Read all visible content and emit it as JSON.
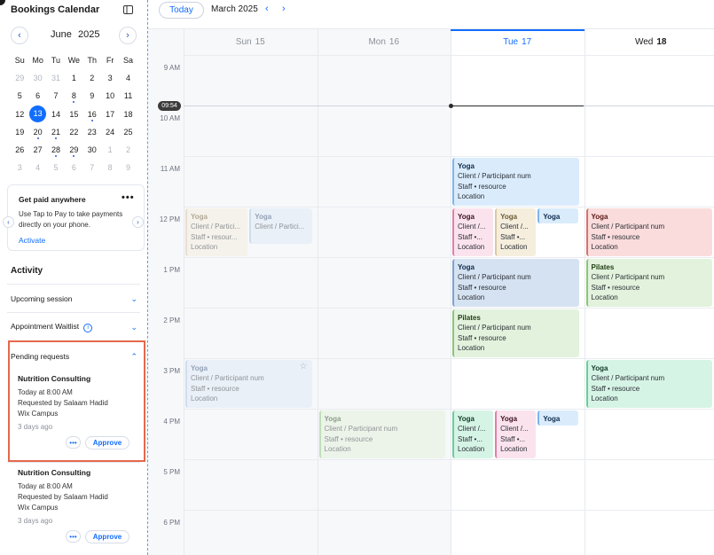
{
  "sidebar": {
    "title": "Bookings Calendar",
    "mini_calendar": {
      "month": "June",
      "year": "2025",
      "prev": "‹",
      "next": "›",
      "weekdays": [
        "Su",
        "Mo",
        "Tu",
        "We",
        "Th",
        "Fr",
        "Sa"
      ],
      "weeks": [
        [
          {
            "d": "29",
            "m": true
          },
          {
            "d": "30",
            "m": true
          },
          {
            "d": "31",
            "m": true
          },
          {
            "d": "1"
          },
          {
            "d": "2"
          },
          {
            "d": "3"
          },
          {
            "d": "4"
          }
        ],
        [
          {
            "d": "5"
          },
          {
            "d": "6"
          },
          {
            "d": "7"
          },
          {
            "d": "8",
            "dot": true
          },
          {
            "d": "9"
          },
          {
            "d": "10"
          },
          {
            "d": "11"
          }
        ],
        [
          {
            "d": "12"
          },
          {
            "d": "13",
            "sel": true
          },
          {
            "d": "14"
          },
          {
            "d": "15"
          },
          {
            "d": "16",
            "dot": true
          },
          {
            "d": "17"
          },
          {
            "d": "18"
          }
        ],
        [
          {
            "d": "19"
          },
          {
            "d": "20",
            "dot": true
          },
          {
            "d": "21",
            "dot": true
          },
          {
            "d": "22"
          },
          {
            "d": "23"
          },
          {
            "d": "24"
          },
          {
            "d": "25"
          }
        ],
        [
          {
            "d": "26"
          },
          {
            "d": "27"
          },
          {
            "d": "28",
            "dot": true
          },
          {
            "d": "29",
            "dot": true
          },
          {
            "d": "30"
          },
          {
            "d": "1",
            "m": true
          },
          {
            "d": "2",
            "m": true
          }
        ],
        [
          {
            "d": "3",
            "m": true
          },
          {
            "d": "4",
            "m": true
          },
          {
            "d": "5",
            "m": true
          },
          {
            "d": "6",
            "m": true
          },
          {
            "d": "7",
            "m": true
          },
          {
            "d": "8",
            "m": true
          },
          {
            "d": "9",
            "m": true
          }
        ]
      ]
    },
    "promo": {
      "title": "Get paid anywhere",
      "more": "•••",
      "text": "Use Tap to Pay to take payments directly on your phone.",
      "link": "Activate",
      "left_arrow": "‹",
      "right_arrow": "›"
    },
    "activity": {
      "heading": "Activity",
      "upcoming": "Upcoming session",
      "waitlist": "Appointment Waitlist",
      "info": "i",
      "pending": "Pending requests",
      "chevron_down": "⌄",
      "chevron_up": "⌃"
    },
    "requests": [
      {
        "title": "Nutrition Consulting",
        "time": "Today at 8:00 AM",
        "by": "Requested by Salaam Hadid",
        "place": "Wix Campus",
        "ago": "3 days ago",
        "more": "•••",
        "approve": "Approve"
      },
      {
        "title": "Nutrition Consulting",
        "time": "Today at 8:00 AM",
        "by": "Requested by Salaam Hadid",
        "place": "Wix Campus",
        "ago": "3 days ago",
        "more": "•••",
        "approve": "Approve"
      }
    ]
  },
  "calendar": {
    "today_label": "Today",
    "current_month": "March 2025",
    "prev": "‹",
    "next": "›",
    "now_time": "09:54",
    "days": [
      {
        "dow": "Sun",
        "num": "15"
      },
      {
        "dow": "Mon",
        "num": "16"
      },
      {
        "dow": "Tue",
        "num": "17"
      },
      {
        "dow": "Wed",
        "num": "18"
      }
    ],
    "hours": [
      "9 AM",
      "10 AM",
      "11 AM",
      "12 PM",
      "1 PM",
      "2 PM",
      "3 PM",
      "4 PM",
      "5 PM",
      "6 PM"
    ],
    "events": [
      {
        "day": 0,
        "start": 12,
        "dur": 1,
        "lane": 0,
        "lanes": 2,
        "title": "Yoga",
        "lines": [
          "Client / Partici...",
          "Staff  •  resour...",
          "Location"
        ],
        "color": "beige",
        "faded": true
      },
      {
        "day": 0,
        "start": 12,
        "dur": 0.75,
        "lane": 1,
        "lanes": 2,
        "title": "Yoga",
        "lines": [
          "Client / Partici..."
        ],
        "color": "blue",
        "faded": true
      },
      {
        "day": 0,
        "start": 15,
        "dur": 1,
        "lane": 0,
        "lanes": 1,
        "title": "Yoga",
        "lines": [
          "Client / Participant num",
          "Staff  •  resource",
          "Location"
        ],
        "color": "blue",
        "faded": true,
        "star": "☆"
      },
      {
        "day": 1,
        "start": 16,
        "dur": 1,
        "lane": 0,
        "lanes": 1,
        "title": "Yoga",
        "lines": [
          "Client / Participant num",
          "Staff  •  resource",
          "Location"
        ],
        "color": "green",
        "faded": true
      },
      {
        "day": 2,
        "start": 11,
        "dur": 1,
        "lane": 0,
        "lanes": 1,
        "title": "Yoga",
        "lines": [
          "Client / Participant num",
          "Staff  •  resource",
          "Location"
        ],
        "color": "lightblue"
      },
      {
        "day": 2,
        "start": 12,
        "dur": 1,
        "lane": 0,
        "lanes": 3,
        "title": "Yoga",
        "lines": [
          "Client /...",
          "Staff  •...",
          "Location"
        ],
        "color": "pink"
      },
      {
        "day": 2,
        "start": 12,
        "dur": 1,
        "lane": 1,
        "lanes": 3,
        "title": "Yoga",
        "lines": [
          "Client /...",
          "Staff  •...",
          "Location"
        ],
        "color": "beige"
      },
      {
        "day": 2,
        "start": 12,
        "dur": 0.35,
        "lane": 2,
        "lanes": 3,
        "title": "Yoga",
        "lines": [],
        "color": "lightblue"
      },
      {
        "day": 2,
        "start": 13,
        "dur": 1,
        "lane": 0,
        "lanes": 1,
        "title": "Yoga",
        "lines": [
          "Client / Participant num",
          "Staff  •  resource",
          "Location"
        ],
        "color": "steel"
      },
      {
        "day": 2,
        "start": 14,
        "dur": 1,
        "lane": 0,
        "lanes": 1,
        "title": "Pilates",
        "lines": [
          "Client / Participant num",
          "Staff  •  resource",
          "Location"
        ],
        "color": "green"
      },
      {
        "day": 2,
        "start": 16,
        "dur": 1,
        "lane": 0,
        "lanes": 3,
        "title": "Yoga",
        "lines": [
          "Client /...",
          "Staff  •...",
          "Location"
        ],
        "color": "mint"
      },
      {
        "day": 2,
        "start": 16,
        "dur": 1,
        "lane": 1,
        "lanes": 3,
        "title": "Yoga",
        "lines": [
          "Client /...",
          "Staff  •...",
          "Location"
        ],
        "color": "pink"
      },
      {
        "day": 2,
        "start": 16,
        "dur": 0.35,
        "lane": 2,
        "lanes": 3,
        "title": "Yoga",
        "lines": [],
        "color": "lightblue"
      },
      {
        "day": 3,
        "start": 12,
        "dur": 1,
        "lane": 0,
        "lanes": 1,
        "title": "Yoga",
        "lines": [
          "Client / Participant num",
          "Staff  •  resource",
          "Location"
        ],
        "color": "red"
      },
      {
        "day": 3,
        "start": 13,
        "dur": 1,
        "lane": 0,
        "lanes": 1,
        "title": "Pilates",
        "lines": [
          "Client / Participant num",
          "Staff  •  resource",
          "Location"
        ],
        "color": "green"
      },
      {
        "day": 3,
        "start": 15,
        "dur": 1,
        "lane": 0,
        "lanes": 1,
        "title": "Yoga",
        "lines": [
          "Client / Participant num",
          "Staff  •  resource",
          "Location"
        ],
        "color": "mint"
      }
    ]
  },
  "colors": {
    "accent": "#116dff",
    "highlight_border": "#e5684c",
    "beige": {
      "bg": "#f5eedd",
      "border": "#d9c9a3",
      "title": "#6b5a33"
    },
    "blue": {
      "bg": "#dde9f7",
      "border": "#a9c3e6",
      "title": "#2f4b73"
    },
    "lightblue": {
      "bg": "#daecfc",
      "border": "#7fb4ec",
      "title": "#0d2a4a"
    },
    "steel": {
      "bg": "#d5e2f1",
      "border": "#7ea2cf",
      "title": "#0d2a4a"
    },
    "pink": {
      "bg": "#fbe3ee",
      "border": "#e07fa9",
      "title": "#3a1020"
    },
    "red": {
      "bg": "#fadcdc",
      "border": "#d96f6f",
      "title": "#5a1414"
    },
    "green": {
      "bg": "#e2f2dc",
      "border": "#8cc47a",
      "title": "#1f3d12"
    },
    "mint": {
      "bg": "#d6f4e6",
      "border": "#6ccb9d",
      "title": "#0f3a24"
    }
  }
}
